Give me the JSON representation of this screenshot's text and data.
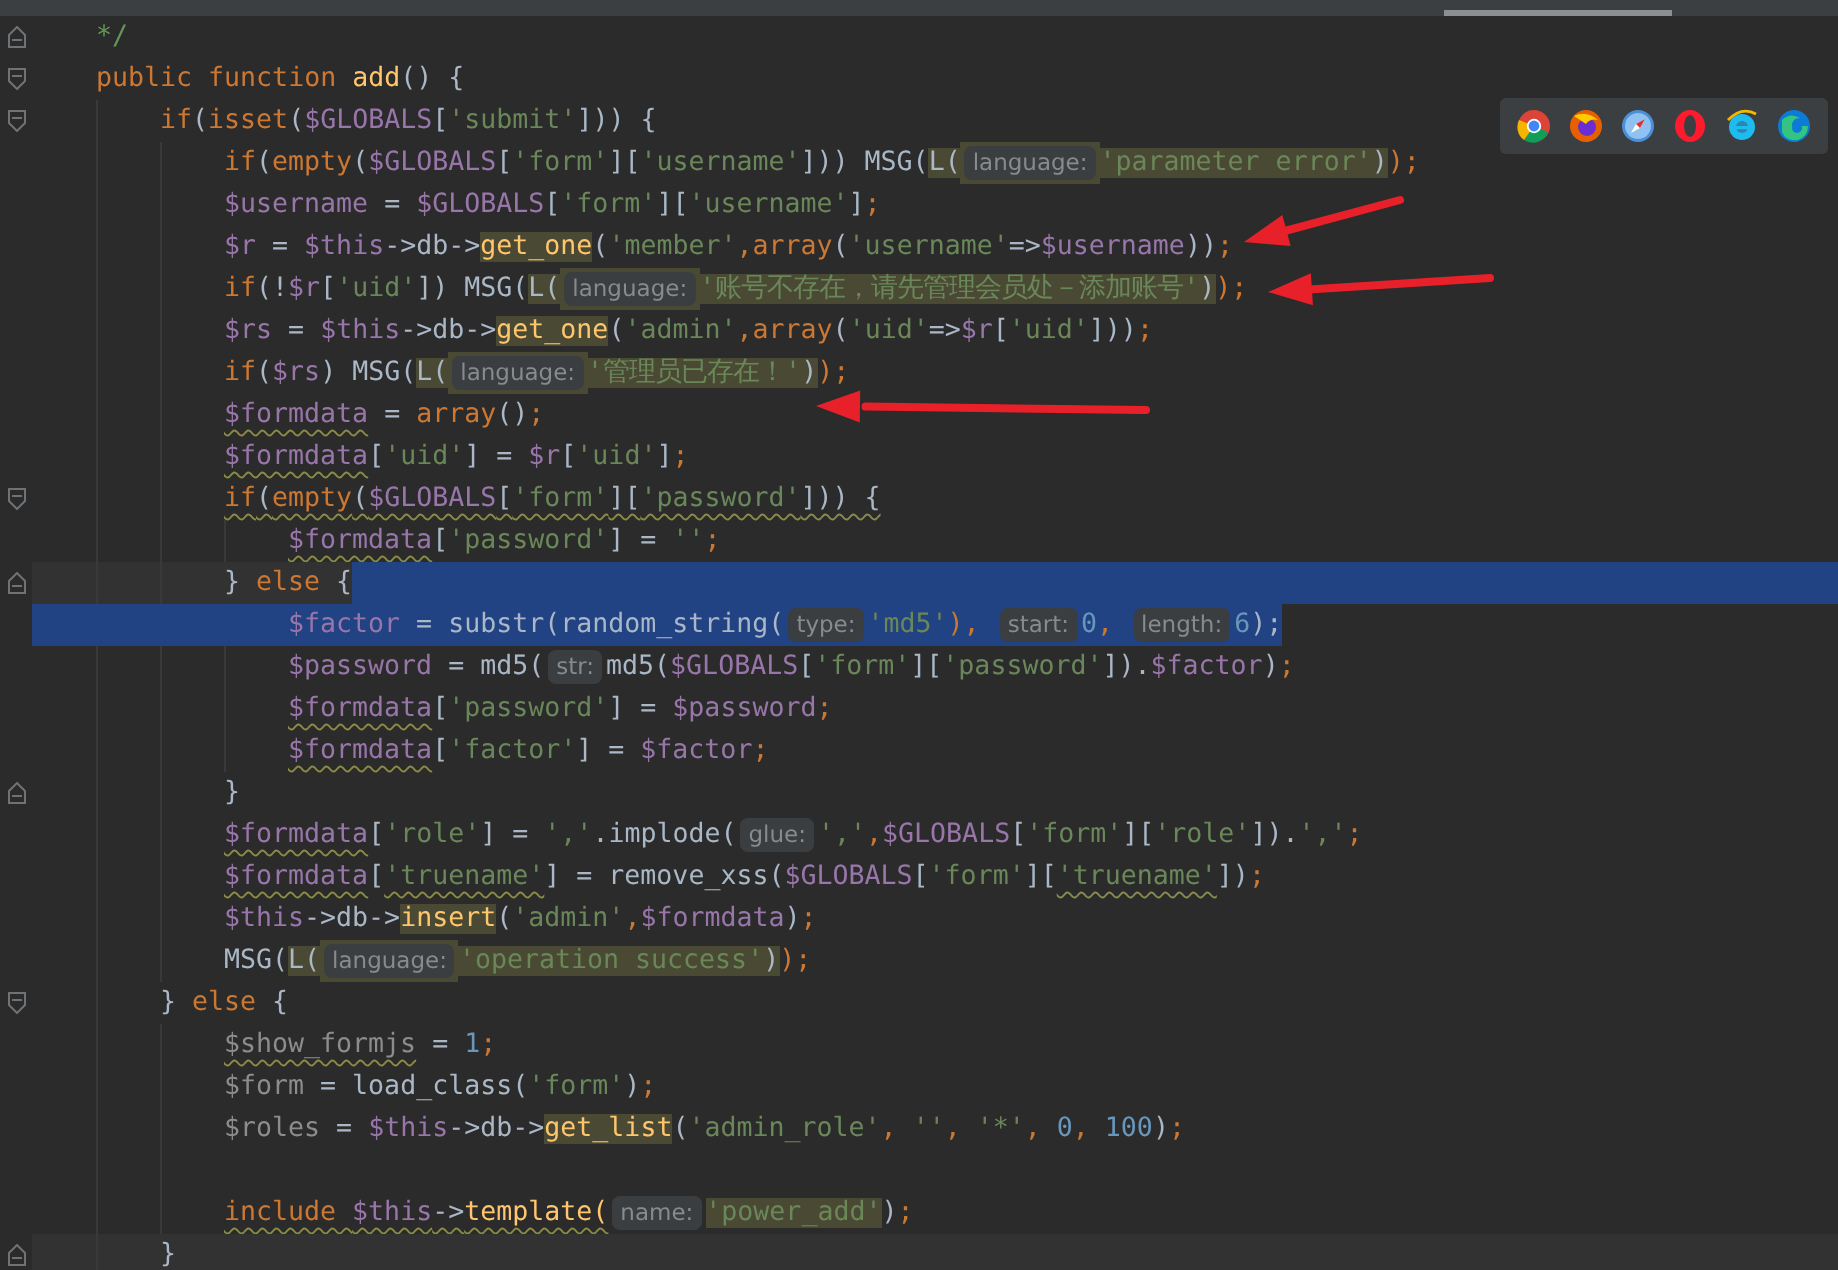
{
  "lines": [
    {
      "block_end": true,
      "tokens": [
        {
          "text": "*/",
          "kind": "comment"
        }
      ]
    },
    {
      "foldable": true,
      "tokens": [
        {
          "text": "public function ",
          "kind": "keyword"
        },
        {
          "text": "add",
          "kind": "function"
        },
        {
          "text": "() {",
          "kind": "plain"
        }
      ],
      "children": [
        {
          "foldable": true,
          "tokens": [
            {
              "text": "if",
              "kind": "keyword"
            },
            {
              "text": "(",
              "kind": "plain"
            },
            {
              "text": "isset",
              "kind": "keyword"
            },
            {
              "text": "(",
              "kind": "plain"
            },
            {
              "text": "$GLOBALS",
              "kind": "variable"
            },
            {
              "text": "[",
              "kind": "plain"
            },
            {
              "text": "'submit'",
              "kind": "string"
            },
            {
              "text": "])) {",
              "kind": "plain"
            }
          ],
          "children": [
            {
              "tokens": [
                {
                  "text": "if",
                  "kind": "keyword"
                },
                {
                  "text": "(",
                  "kind": "plain"
                },
                {
                  "text": "empty",
                  "kind": "keyword"
                },
                {
                  "text": "(",
                  "kind": "plain"
                },
                {
                  "text": "$GLOBALS",
                  "kind": "variable"
                },
                {
                  "text": "[",
                  "kind": "plain"
                },
                {
                  "text": "'form'",
                  "kind": "string"
                },
                {
                  "text": "][",
                  "kind": "plain"
                },
                {
                  "text": "'username'",
                  "kind": "string"
                },
                {
                  "text": "])) MSG(",
                  "kind": "plain"
                },
                {
                  "text": "L(",
                  "kind": "plain",
                  "highlighted": true
                },
                {
                  "text": "language:",
                  "kind": "hint",
                  "highlighted": true
                },
                {
                  "text": "'parameter error'",
                  "kind": "string",
                  "highlighted": true
                },
                {
                  "text": ")",
                  "kind": "plain",
                  "highlighted": true
                },
                {
                  "text": ");",
                  "kind": "keyword"
                }
              ]
            },
            {
              "tokens": [
                {
                  "text": "$username",
                  "kind": "variable"
                },
                {
                  "text": " = ",
                  "kind": "plain"
                },
                {
                  "text": "$GLOBALS",
                  "kind": "variable"
                },
                {
                  "text": "[",
                  "kind": "plain"
                },
                {
                  "text": "'form'",
                  "kind": "string"
                },
                {
                  "text": "][",
                  "kind": "plain"
                },
                {
                  "text": "'username'",
                  "kind": "string"
                },
                {
                  "text": "]",
                  "kind": "plain"
                },
                {
                  "text": ";",
                  "kind": "keyword"
                }
              ]
            },
            {
              "tokens": [
                {
                  "text": "$r",
                  "kind": "variable"
                },
                {
                  "text": " = ",
                  "kind": "plain"
                },
                {
                  "text": "$this",
                  "kind": "variable"
                },
                {
                  "text": "->db->",
                  "kind": "plain"
                },
                {
                  "text": "get_one",
                  "kind": "function",
                  "highlighted": true
                },
                {
                  "text": "(",
                  "kind": "plain"
                },
                {
                  "text": "'member'",
                  "kind": "string"
                },
                {
                  "text": ",",
                  "kind": "keyword"
                },
                {
                  "text": "array",
                  "kind": "keyword"
                },
                {
                  "text": "(",
                  "kind": "plain"
                },
                {
                  "text": "'username'",
                  "kind": "string"
                },
                {
                  "text": "=>",
                  "kind": "plain"
                },
                {
                  "text": "$username",
                  "kind": "variable"
                },
                {
                  "text": "))",
                  "kind": "plain"
                },
                {
                  "text": ";",
                  "kind": "keyword"
                }
              ]
            },
            {
              "tokens": [
                {
                  "text": "if",
                  "kind": "keyword"
                },
                {
                  "text": "(!",
                  "kind": "plain"
                },
                {
                  "text": "$r",
                  "kind": "variable"
                },
                {
                  "text": "[",
                  "kind": "plain"
                },
                {
                  "text": "'uid'",
                  "kind": "string"
                },
                {
                  "text": "]) MSG(",
                  "kind": "plain"
                },
                {
                  "text": "L(",
                  "kind": "plain",
                  "highlighted": true
                },
                {
                  "text": "language:",
                  "kind": "hint",
                  "highlighted": true
                },
                {
                  "text": "'账号不存在，请先管理会员处－添加账号'",
                  "kind": "string",
                  "highlighted": true
                },
                {
                  "text": ")",
                  "kind": "plain",
                  "highlighted": true
                },
                {
                  "text": ");",
                  "kind": "keyword"
                }
              ]
            },
            {
              "tokens": [
                {
                  "text": "$rs",
                  "kind": "variable"
                },
                {
                  "text": " = ",
                  "kind": "plain"
                },
                {
                  "text": "$this",
                  "kind": "variable"
                },
                {
                  "text": "->db->",
                  "kind": "plain"
                },
                {
                  "text": "get_one",
                  "kind": "function",
                  "highlighted": true
                },
                {
                  "text": "(",
                  "kind": "plain"
                },
                {
                  "text": "'admin'",
                  "kind": "string"
                },
                {
                  "text": ",",
                  "kind": "keyword"
                },
                {
                  "text": "array",
                  "kind": "keyword"
                },
                {
                  "text": "(",
                  "kind": "plain"
                },
                {
                  "text": "'uid'",
                  "kind": "string"
                },
                {
                  "text": "=>",
                  "kind": "plain"
                },
                {
                  "text": "$r",
                  "kind": "variable"
                },
                {
                  "text": "[",
                  "kind": "plain"
                },
                {
                  "text": "'uid'",
                  "kind": "string"
                },
                {
                  "text": "]))",
                  "kind": "plain"
                },
                {
                  "text": ";",
                  "kind": "keyword"
                }
              ]
            },
            {
              "tokens": [
                {
                  "text": "if",
                  "kind": "keyword"
                },
                {
                  "text": "(",
                  "kind": "plain"
                },
                {
                  "text": "$rs",
                  "kind": "variable"
                },
                {
                  "text": ") MSG(",
                  "kind": "plain"
                },
                {
                  "text": "L(",
                  "kind": "plain",
                  "highlighted": true
                },
                {
                  "text": "language:",
                  "kind": "hint",
                  "highlighted": true
                },
                {
                  "text": "'管理员已存在！'",
                  "kind": "string",
                  "highlighted": true
                },
                {
                  "text": ")",
                  "kind": "plain",
                  "highlighted": true
                },
                {
                  "text": ");",
                  "kind": "keyword"
                }
              ]
            },
            {
              "tokens": [
                {
                  "text": "$formdata",
                  "kind": "variable",
                  "warning": true
                },
                {
                  "text": " = ",
                  "kind": "plain"
                },
                {
                  "text": "array",
                  "kind": "keyword"
                },
                {
                  "text": "()",
                  "kind": "plain"
                },
                {
                  "text": ";",
                  "kind": "keyword"
                }
              ]
            },
            {
              "tokens": [
                {
                  "text": "$formdata",
                  "kind": "variable",
                  "warning": true
                },
                {
                  "text": "[",
                  "kind": "plain"
                },
                {
                  "text": "'uid'",
                  "kind": "string"
                },
                {
                  "text": "] = ",
                  "kind": "plain"
                },
                {
                  "text": "$r",
                  "kind": "variable"
                },
                {
                  "text": "[",
                  "kind": "plain"
                },
                {
                  "text": "'uid'",
                  "kind": "string"
                },
                {
                  "text": "]",
                  "kind": "plain"
                },
                {
                  "text": ";",
                  "kind": "keyword"
                }
              ]
            },
            {
              "foldable": true,
              "tokens": [
                {
                  "text": "if",
                  "kind": "keyword",
                  "warning": true
                },
                {
                  "text": "(",
                  "kind": "plain",
                  "warning": true
                },
                {
                  "text": "empty",
                  "kind": "keyword",
                  "warning": true
                },
                {
                  "text": "(",
                  "kind": "plain",
                  "warning": true
                },
                {
                  "text": "$GLOBALS",
                  "kind": "variable",
                  "warning": true
                },
                {
                  "text": "[",
                  "kind": "plain",
                  "warning": true
                },
                {
                  "text": "'form'",
                  "kind": "string",
                  "warning": true
                },
                {
                  "text": "][",
                  "kind": "plain",
                  "warning": true
                },
                {
                  "text": "'password'",
                  "kind": "string",
                  "warning": true
                },
                {
                  "text": "])) {",
                  "kind": "plain",
                  "warning": true
                }
              ],
              "children": [
                {
                  "tokens": [
                    {
                      "text": "$formdata",
                      "kind": "variable",
                      "warning": true
                    },
                    {
                      "text": "[",
                      "kind": "plain"
                    },
                    {
                      "text": "'password'",
                      "kind": "string"
                    },
                    {
                      "text": "] = ",
                      "kind": "plain"
                    },
                    {
                      "text": "''",
                      "kind": "string"
                    },
                    {
                      "text": ";",
                      "kind": "keyword"
                    }
                  ]
                }
              ]
            },
            {
              "block_end": true,
              "current": true,
              "selection_tail": true,
              "tokens": [
                {
                  "text": "} ",
                  "kind": "plain"
                },
                {
                  "text": "else",
                  "kind": "keyword"
                },
                {
                  "text": " {",
                  "kind": "plain"
                }
              ],
              "children": [
                {
                  "selected": true,
                  "tokens": [
                    {
                      "text": "$factor",
                      "kind": "variable"
                    },
                    {
                      "text": " = substr(random_string(",
                      "kind": "plain"
                    },
                    {
                      "text": "type:",
                      "kind": "hint"
                    },
                    {
                      "text": "'md5'",
                      "kind": "string"
                    },
                    {
                      "text": "), ",
                      "kind": "keyword"
                    },
                    {
                      "text": "start:",
                      "kind": "hint"
                    },
                    {
                      "text": "0",
                      "kind": "number"
                    },
                    {
                      "text": ", ",
                      "kind": "keyword"
                    },
                    {
                      "text": "length:",
                      "kind": "hint"
                    },
                    {
                      "text": "6",
                      "kind": "number"
                    },
                    {
                      "text": ");",
                      "kind": "plain"
                    }
                  ]
                },
                {
                  "tokens": [
                    {
                      "text": "$password",
                      "kind": "variable"
                    },
                    {
                      "text": " = md5(",
                      "kind": "plain"
                    },
                    {
                      "text": "str:",
                      "kind": "hint"
                    },
                    {
                      "text": "md5(",
                      "kind": "plain"
                    },
                    {
                      "text": "$GLOBALS",
                      "kind": "variable"
                    },
                    {
                      "text": "[",
                      "kind": "plain"
                    },
                    {
                      "text": "'form'",
                      "kind": "string"
                    },
                    {
                      "text": "][",
                      "kind": "plain"
                    },
                    {
                      "text": "'password'",
                      "kind": "string"
                    },
                    {
                      "text": "]).",
                      "kind": "plain"
                    },
                    {
                      "text": "$factor",
                      "kind": "variable"
                    },
                    {
                      "text": ")",
                      "kind": "plain"
                    },
                    {
                      "text": ";",
                      "kind": "keyword"
                    }
                  ]
                },
                {
                  "tokens": [
                    {
                      "text": "$formdata",
                      "kind": "variable",
                      "warning": true
                    },
                    {
                      "text": "[",
                      "kind": "plain"
                    },
                    {
                      "text": "'password'",
                      "kind": "string"
                    },
                    {
                      "text": "] = ",
                      "kind": "plain"
                    },
                    {
                      "text": "$password",
                      "kind": "variable"
                    },
                    {
                      "text": ";",
                      "kind": "keyword"
                    }
                  ]
                },
                {
                  "tokens": [
                    {
                      "text": "$formdata",
                      "kind": "variable",
                      "warning": true
                    },
                    {
                      "text": "[",
                      "kind": "plain"
                    },
                    {
                      "text": "'factor'",
                      "kind": "string"
                    },
                    {
                      "text": "] = ",
                      "kind": "plain"
                    },
                    {
                      "text": "$factor",
                      "kind": "variable"
                    },
                    {
                      "text": ";",
                      "kind": "keyword"
                    }
                  ]
                }
              ]
            },
            {
              "block_end": true,
              "tokens": [
                {
                  "text": "}",
                  "kind": "plain"
                }
              ]
            },
            {
              "tokens": [
                {
                  "text": "$formdata",
                  "kind": "variable",
                  "warning": true
                },
                {
                  "text": "[",
                  "kind": "plain"
                },
                {
                  "text": "'role'",
                  "kind": "string"
                },
                {
                  "text": "] = ",
                  "kind": "plain"
                },
                {
                  "text": "','",
                  "kind": "string"
                },
                {
                  "text": ".implode(",
                  "kind": "plain"
                },
                {
                  "text": "glue:",
                  "kind": "hint"
                },
                {
                  "text": "','",
                  "kind": "string"
                },
                {
                  "text": ",",
                  "kind": "keyword"
                },
                {
                  "text": "$GLOBALS",
                  "kind": "variable"
                },
                {
                  "text": "[",
                  "kind": "plain"
                },
                {
                  "text": "'form'",
                  "kind": "string"
                },
                {
                  "text": "][",
                  "kind": "plain"
                },
                {
                  "text": "'role'",
                  "kind": "string"
                },
                {
                  "text": "]).",
                  "kind": "plain"
                },
                {
                  "text": "','",
                  "kind": "string"
                },
                {
                  "text": ";",
                  "kind": "keyword"
                }
              ]
            },
            {
              "tokens": [
                {
                  "text": "$formdata",
                  "kind": "variable",
                  "warning": true
                },
                {
                  "text": "[",
                  "kind": "plain"
                },
                {
                  "text": "'truename'",
                  "kind": "string",
                  "warning": true
                },
                {
                  "text": "] = remove_xss(",
                  "kind": "plain"
                },
                {
                  "text": "$GLOBALS",
                  "kind": "variable"
                },
                {
                  "text": "[",
                  "kind": "plain"
                },
                {
                  "text": "'form'",
                  "kind": "string"
                },
                {
                  "text": "][",
                  "kind": "plain"
                },
                {
                  "text": "'truename'",
                  "kind": "string",
                  "warning": true
                },
                {
                  "text": "])",
                  "kind": "plain"
                },
                {
                  "text": ";",
                  "kind": "keyword"
                }
              ]
            },
            {
              "tokens": [
                {
                  "text": "$this",
                  "kind": "variable"
                },
                {
                  "text": "->db->",
                  "kind": "plain"
                },
                {
                  "text": "insert",
                  "kind": "function",
                  "highlighted": true
                },
                {
                  "text": "(",
                  "kind": "plain"
                },
                {
                  "text": "'admin'",
                  "kind": "string"
                },
                {
                  "text": ",",
                  "kind": "keyword"
                },
                {
                  "text": "$formdata",
                  "kind": "variable"
                },
                {
                  "text": ")",
                  "kind": "plain"
                },
                {
                  "text": ";",
                  "kind": "keyword"
                }
              ]
            },
            {
              "tokens": [
                {
                  "text": "MSG(",
                  "kind": "plain"
                },
                {
                  "text": "L(",
                  "kind": "plain",
                  "highlighted": true
                },
                {
                  "text": "language:",
                  "kind": "hint",
                  "highlighted": true
                },
                {
                  "text": "'operation success'",
                  "kind": "string",
                  "highlighted": true
                },
                {
                  "text": ")",
                  "kind": "plain",
                  "highlighted": true
                },
                {
                  "text": ");",
                  "kind": "keyword"
                }
              ]
            }
          ]
        },
        {
          "foldable": true,
          "tokens": [
            {
              "text": "} ",
              "kind": "plain"
            },
            {
              "text": "else",
              "kind": "keyword"
            },
            {
              "text": " {",
              "kind": "plain"
            }
          ],
          "children": [
            {
              "tokens": [
                {
                  "text": "$show_formjs",
                  "kind": "unused",
                  "warning": true
                },
                {
                  "text": " = ",
                  "kind": "plain"
                },
                {
                  "text": "1",
                  "kind": "number"
                },
                {
                  "text": ";",
                  "kind": "keyword"
                }
              ]
            },
            {
              "tokens": [
                {
                  "text": "$form",
                  "kind": "unused"
                },
                {
                  "text": " = load_class(",
                  "kind": "plain"
                },
                {
                  "text": "'form'",
                  "kind": "string"
                },
                {
                  "text": ")",
                  "kind": "plain"
                },
                {
                  "text": ";",
                  "kind": "keyword"
                }
              ]
            },
            {
              "tokens": [
                {
                  "text": "$roles",
                  "kind": "unused"
                },
                {
                  "text": " = ",
                  "kind": "plain"
                },
                {
                  "text": "$this",
                  "kind": "variable"
                },
                {
                  "text": "->db->",
                  "kind": "plain"
                },
                {
                  "text": "get_list",
                  "kind": "function",
                  "highlighted": true
                },
                {
                  "text": "(",
                  "kind": "plain"
                },
                {
                  "text": "'admin_role'",
                  "kind": "string"
                },
                {
                  "text": ", ",
                  "kind": "keyword"
                },
                {
                  "text": "''",
                  "kind": "string"
                },
                {
                  "text": ", ",
                  "kind": "keyword"
                },
                {
                  "text": "'*'",
                  "kind": "string"
                },
                {
                  "text": ", ",
                  "kind": "keyword"
                },
                {
                  "text": "0",
                  "kind": "number"
                },
                {
                  "text": ", ",
                  "kind": "keyword"
                },
                {
                  "text": "100",
                  "kind": "number"
                },
                {
                  "text": ")",
                  "kind": "plain"
                },
                {
                  "text": ";",
                  "kind": "keyword"
                }
              ]
            },
            {
              "kind": "blank"
            },
            {
              "tokens": [
                {
                  "text": "include ",
                  "kind": "keyword",
                  "warning": true
                },
                {
                  "text": "$this",
                  "kind": "variable",
                  "warning": true
                },
                {
                  "text": "->",
                  "kind": "plain",
                  "warning": true
                },
                {
                  "text": "template(",
                  "kind": "function",
                  "warning": true
                },
                {
                  "text": "name:",
                  "kind": "hint",
                  "warning": true
                },
                {
                  "text": "'power_add'",
                  "kind": "string",
                  "highlighted": true
                },
                {
                  "text": ")",
                  "kind": "plain"
                },
                {
                  "text": ";",
                  "kind": "keyword"
                }
              ]
            }
          ]
        },
        {
          "block_end": true,
          "current": true,
          "tokens": [
            {
              "text": "}",
              "kind": "plain"
            }
          ]
        }
      ]
    }
  ],
  "browser_icons": [
    {
      "kind": "chrome"
    },
    {
      "kind": "firefox"
    },
    {
      "kind": "safari"
    },
    {
      "kind": "opera"
    },
    {
      "kind": "ie"
    },
    {
      "kind": "edge"
    }
  ],
  "annotations": [
    {
      "kind": "arrow"
    },
    {
      "kind": "arrow"
    },
    {
      "kind": "arrow"
    }
  ]
}
